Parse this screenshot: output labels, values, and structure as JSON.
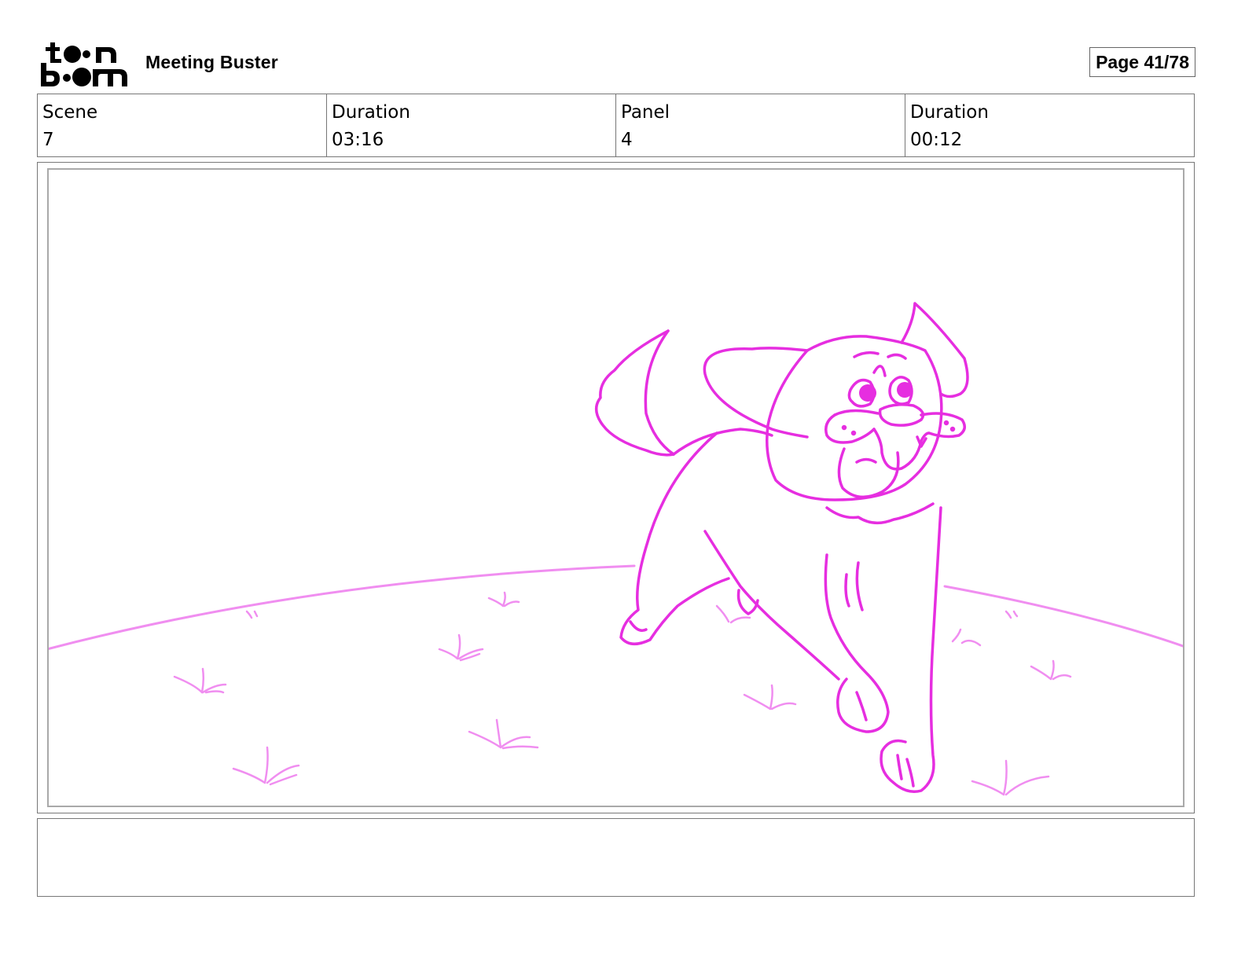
{
  "header": {
    "logo_text": "toon boom",
    "project_title": "Meeting Buster",
    "page_label": "Page 41/78"
  },
  "info": {
    "scene_label": "Scene",
    "scene_value": "7",
    "scene_duration_label": "Duration",
    "scene_duration_value": "03:16",
    "panel_label": "Panel",
    "panel_value": "4",
    "panel_duration_label": "Duration",
    "panel_duration_value": "00:12"
  },
  "colors": {
    "sketch_stroke": "#e62ee0",
    "sketch_light": "#f08ef0",
    "frame_border": "#777777"
  },
  "icons": {
    "logo": "toon-boom-logo"
  },
  "notes": {
    "text": ""
  }
}
